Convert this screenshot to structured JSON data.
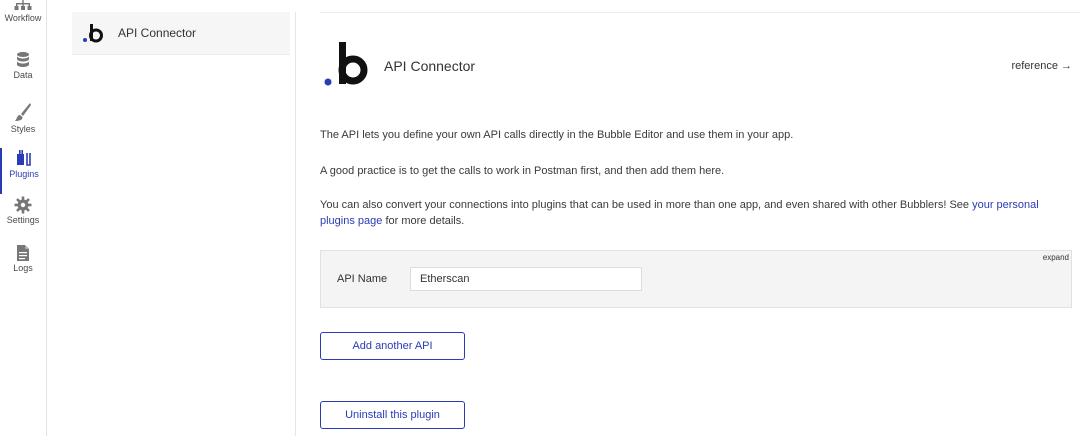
{
  "rail": {
    "items": [
      {
        "label": "Workflow",
        "icon": "workflow-icon"
      },
      {
        "label": "Data",
        "icon": "database-icon"
      },
      {
        "label": "Styles",
        "icon": "brush-icon"
      },
      {
        "label": "Plugins",
        "icon": "plugin-icon",
        "active": true
      },
      {
        "label": "Settings",
        "icon": "gear-icon"
      },
      {
        "label": "Logs",
        "icon": "document-icon"
      }
    ]
  },
  "plugin_list": {
    "items": [
      {
        "label": "API Connector"
      }
    ]
  },
  "main": {
    "title": "API Connector",
    "reference_link": "reference →",
    "para1": "The API lets you define your own API calls directly in the Bubble Editor and use them in your app.",
    "para2": "A good practice is to get the calls to work in Postman first, and then add them here.",
    "para3_prefix": "You can also convert your connections into plugins that can be used in more than one app, and even shared with other Bubblers! See ",
    "para3_link": "your personal plugins page",
    "para3_suffix": " for more details.",
    "api_panel": {
      "expand_label": "expand",
      "name_label": "API Name",
      "name_value": "Etherscan"
    },
    "add_api_button": "Add another API",
    "uninstall_button": "Uninstall this plugin"
  },
  "colors": {
    "accent": "#2a3cb5",
    "panel_bg": "#f4f4f4"
  }
}
